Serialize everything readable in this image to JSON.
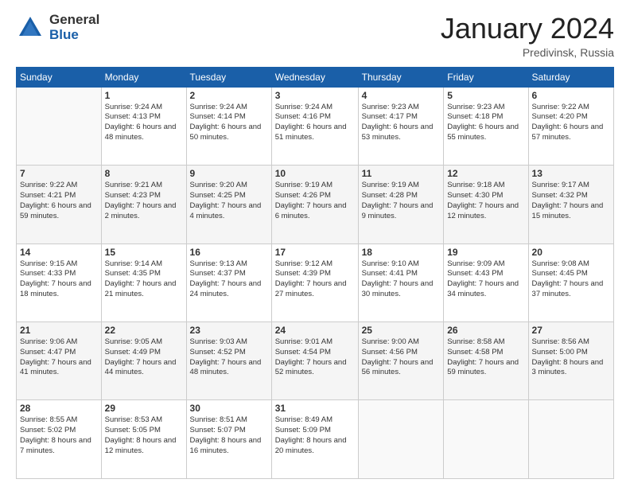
{
  "logo": {
    "general": "General",
    "blue": "Blue"
  },
  "title": {
    "month": "January 2024",
    "location": "Predivinsk, Russia"
  },
  "weekdays": [
    "Sunday",
    "Monday",
    "Tuesday",
    "Wednesday",
    "Thursday",
    "Friday",
    "Saturday"
  ],
  "weeks": [
    [
      {
        "num": "",
        "empty": true
      },
      {
        "num": "1",
        "sunrise": "Sunrise: 9:24 AM",
        "sunset": "Sunset: 4:13 PM",
        "daylight": "Daylight: 6 hours and 48 minutes."
      },
      {
        "num": "2",
        "sunrise": "Sunrise: 9:24 AM",
        "sunset": "Sunset: 4:14 PM",
        "daylight": "Daylight: 6 hours and 50 minutes."
      },
      {
        "num": "3",
        "sunrise": "Sunrise: 9:24 AM",
        "sunset": "Sunset: 4:16 PM",
        "daylight": "Daylight: 6 hours and 51 minutes."
      },
      {
        "num": "4",
        "sunrise": "Sunrise: 9:23 AM",
        "sunset": "Sunset: 4:17 PM",
        "daylight": "Daylight: 6 hours and 53 minutes."
      },
      {
        "num": "5",
        "sunrise": "Sunrise: 9:23 AM",
        "sunset": "Sunset: 4:18 PM",
        "daylight": "Daylight: 6 hours and 55 minutes."
      },
      {
        "num": "6",
        "sunrise": "Sunrise: 9:22 AM",
        "sunset": "Sunset: 4:20 PM",
        "daylight": "Daylight: 6 hours and 57 minutes."
      }
    ],
    [
      {
        "num": "7",
        "sunrise": "Sunrise: 9:22 AM",
        "sunset": "Sunset: 4:21 PM",
        "daylight": "Daylight: 6 hours and 59 minutes."
      },
      {
        "num": "8",
        "sunrise": "Sunrise: 9:21 AM",
        "sunset": "Sunset: 4:23 PM",
        "daylight": "Daylight: 7 hours and 2 minutes."
      },
      {
        "num": "9",
        "sunrise": "Sunrise: 9:20 AM",
        "sunset": "Sunset: 4:25 PM",
        "daylight": "Daylight: 7 hours and 4 minutes."
      },
      {
        "num": "10",
        "sunrise": "Sunrise: 9:19 AM",
        "sunset": "Sunset: 4:26 PM",
        "daylight": "Daylight: 7 hours and 6 minutes."
      },
      {
        "num": "11",
        "sunrise": "Sunrise: 9:19 AM",
        "sunset": "Sunset: 4:28 PM",
        "daylight": "Daylight: 7 hours and 9 minutes."
      },
      {
        "num": "12",
        "sunrise": "Sunrise: 9:18 AM",
        "sunset": "Sunset: 4:30 PM",
        "daylight": "Daylight: 7 hours and 12 minutes."
      },
      {
        "num": "13",
        "sunrise": "Sunrise: 9:17 AM",
        "sunset": "Sunset: 4:32 PM",
        "daylight": "Daylight: 7 hours and 15 minutes."
      }
    ],
    [
      {
        "num": "14",
        "sunrise": "Sunrise: 9:15 AM",
        "sunset": "Sunset: 4:33 PM",
        "daylight": "Daylight: 7 hours and 18 minutes."
      },
      {
        "num": "15",
        "sunrise": "Sunrise: 9:14 AM",
        "sunset": "Sunset: 4:35 PM",
        "daylight": "Daylight: 7 hours and 21 minutes."
      },
      {
        "num": "16",
        "sunrise": "Sunrise: 9:13 AM",
        "sunset": "Sunset: 4:37 PM",
        "daylight": "Daylight: 7 hours and 24 minutes."
      },
      {
        "num": "17",
        "sunrise": "Sunrise: 9:12 AM",
        "sunset": "Sunset: 4:39 PM",
        "daylight": "Daylight: 7 hours and 27 minutes."
      },
      {
        "num": "18",
        "sunrise": "Sunrise: 9:10 AM",
        "sunset": "Sunset: 4:41 PM",
        "daylight": "Daylight: 7 hours and 30 minutes."
      },
      {
        "num": "19",
        "sunrise": "Sunrise: 9:09 AM",
        "sunset": "Sunset: 4:43 PM",
        "daylight": "Daylight: 7 hours and 34 minutes."
      },
      {
        "num": "20",
        "sunrise": "Sunrise: 9:08 AM",
        "sunset": "Sunset: 4:45 PM",
        "daylight": "Daylight: 7 hours and 37 minutes."
      }
    ],
    [
      {
        "num": "21",
        "sunrise": "Sunrise: 9:06 AM",
        "sunset": "Sunset: 4:47 PM",
        "daylight": "Daylight: 7 hours and 41 minutes."
      },
      {
        "num": "22",
        "sunrise": "Sunrise: 9:05 AM",
        "sunset": "Sunset: 4:49 PM",
        "daylight": "Daylight: 7 hours and 44 minutes."
      },
      {
        "num": "23",
        "sunrise": "Sunrise: 9:03 AM",
        "sunset": "Sunset: 4:52 PM",
        "daylight": "Daylight: 7 hours and 48 minutes."
      },
      {
        "num": "24",
        "sunrise": "Sunrise: 9:01 AM",
        "sunset": "Sunset: 4:54 PM",
        "daylight": "Daylight: 7 hours and 52 minutes."
      },
      {
        "num": "25",
        "sunrise": "Sunrise: 9:00 AM",
        "sunset": "Sunset: 4:56 PM",
        "daylight": "Daylight: 7 hours and 56 minutes."
      },
      {
        "num": "26",
        "sunrise": "Sunrise: 8:58 AM",
        "sunset": "Sunset: 4:58 PM",
        "daylight": "Daylight: 7 hours and 59 minutes."
      },
      {
        "num": "27",
        "sunrise": "Sunrise: 8:56 AM",
        "sunset": "Sunset: 5:00 PM",
        "daylight": "Daylight: 8 hours and 3 minutes."
      }
    ],
    [
      {
        "num": "28",
        "sunrise": "Sunrise: 8:55 AM",
        "sunset": "Sunset: 5:02 PM",
        "daylight": "Daylight: 8 hours and 7 minutes."
      },
      {
        "num": "29",
        "sunrise": "Sunrise: 8:53 AM",
        "sunset": "Sunset: 5:05 PM",
        "daylight": "Daylight: 8 hours and 12 minutes."
      },
      {
        "num": "30",
        "sunrise": "Sunrise: 8:51 AM",
        "sunset": "Sunset: 5:07 PM",
        "daylight": "Daylight: 8 hours and 16 minutes."
      },
      {
        "num": "31",
        "sunrise": "Sunrise: 8:49 AM",
        "sunset": "Sunset: 5:09 PM",
        "daylight": "Daylight: 8 hours and 20 minutes."
      },
      {
        "num": "",
        "empty": true
      },
      {
        "num": "",
        "empty": true
      },
      {
        "num": "",
        "empty": true
      }
    ]
  ]
}
